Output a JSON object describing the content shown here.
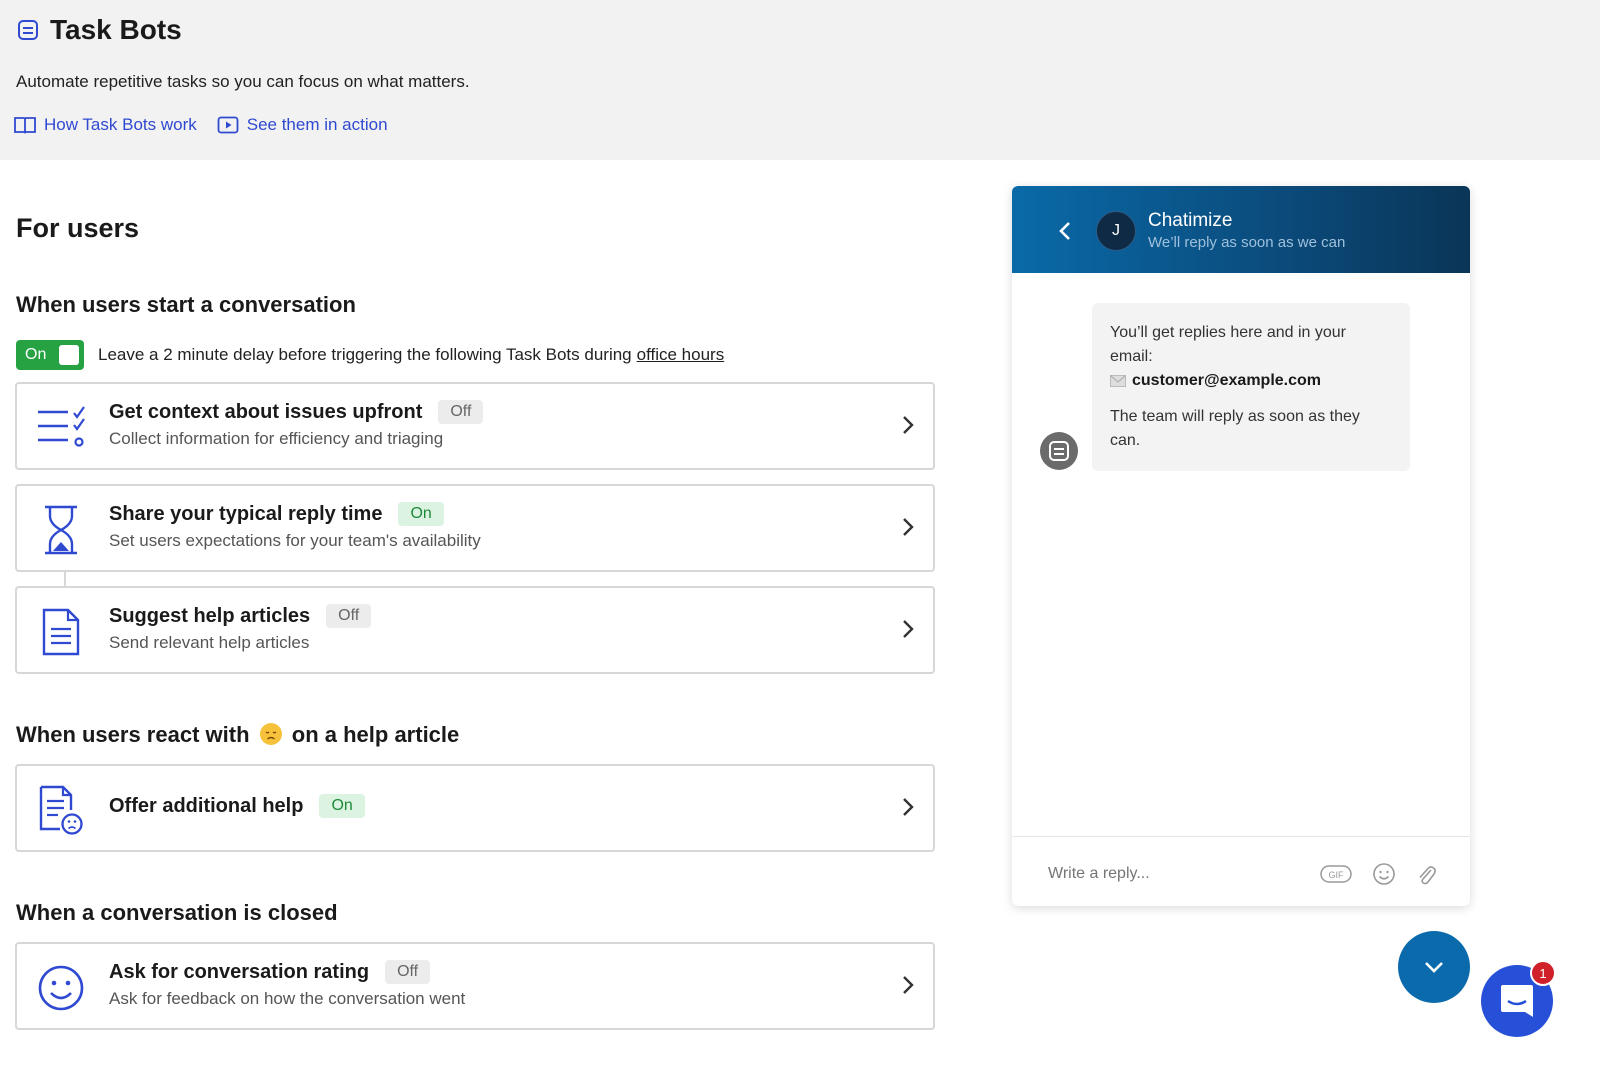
{
  "header": {
    "title": "Task Bots",
    "subtitle": "Automate repetitive tasks so you can focus on what matters.",
    "links": [
      {
        "label": "How Task Bots work",
        "icon": "book-icon"
      },
      {
        "label": "See them in action",
        "icon": "play-icon"
      }
    ]
  },
  "main": {
    "section_title": "For users",
    "groups": [
      {
        "title": "When users start a conversation",
        "delay_toggle": {
          "label": "On",
          "state": "on"
        },
        "delay_text": "Leave a 2 minute delay before triggering the following Task Bots during",
        "delay_link": "office hours",
        "bots": [
          {
            "name": "Get context about issues upfront",
            "status": "Off",
            "description": "Collect information for efficiency and triaging",
            "icon": "checklist-icon"
          },
          {
            "name": "Share your typical reply time",
            "status": "On",
            "description": "Set users expectations for your team's availability",
            "icon": "hourglass-icon"
          },
          {
            "name": "Suggest help articles",
            "status": "Off",
            "description": "Send relevant help articles",
            "icon": "document-icon"
          }
        ]
      },
      {
        "title_before": "When users react with",
        "title_after": "on a help article",
        "bots": [
          {
            "name": "Offer additional help",
            "status": "On",
            "description": "",
            "icon": "sad-document-icon"
          }
        ]
      },
      {
        "title": "When a conversation is closed",
        "bots": [
          {
            "name": "Ask for conversation rating",
            "status": "Off",
            "description": "Ask for feedback on how the conversation went",
            "icon": "smiley-icon"
          }
        ]
      }
    ]
  },
  "chat": {
    "avatar_initial": "J",
    "name": "Chatimize",
    "subtitle": "We’ll reply as soon as we can",
    "message": {
      "line1": "You’ll get replies here and in your email:",
      "email": "customer@example.com",
      "line2": "The team will reply as soon as they can."
    },
    "reply_placeholder": "Write a reply...",
    "gif_label": "GIF"
  },
  "launcher": {
    "badge_count": "1"
  },
  "colors": {
    "accent_blue": "#2f49d1",
    "toggle_green": "#27a243",
    "header_gradient_start": "#0a6aa8",
    "header_gradient_end": "#0a3557",
    "launcher_blue": "#2750d8",
    "badge_red": "#d0212a"
  }
}
